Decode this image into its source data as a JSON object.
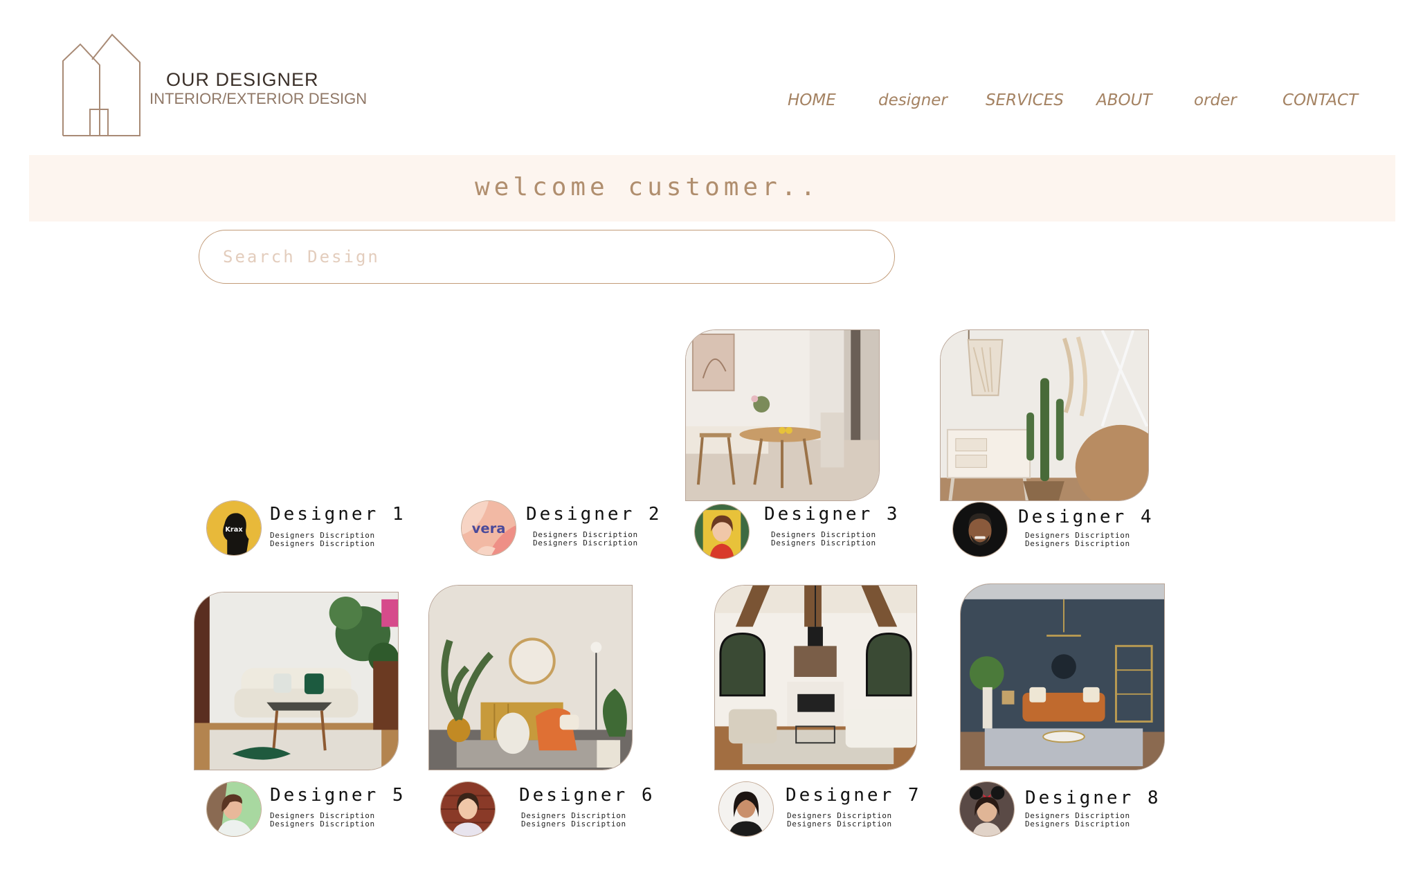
{
  "brand": {
    "title": "OUR DESIGNER",
    "subtitle": "INTERIOR/EXTERIOR DESIGN",
    "logo_icon": "house-outline-icon"
  },
  "nav": {
    "items": [
      {
        "label": "HOME"
      },
      {
        "label": "designer"
      },
      {
        "label": "SERVICES"
      },
      {
        "label": "ABOUT"
      },
      {
        "label": "order"
      },
      {
        "label": "CONTACT"
      }
    ]
  },
  "welcome": {
    "text": "welcome customer.."
  },
  "search": {
    "placeholder": "Search Design",
    "value": ""
  },
  "colors": {
    "accent": "#a48262",
    "band": "#fdf5ef",
    "search_border": "#c29b78"
  },
  "designers": [
    {
      "name": "Designer 1",
      "desc_line1": "Designers Discription",
      "desc_line2": "Designers Discription",
      "avatar_text": "Krax"
    },
    {
      "name": "Designer 2",
      "desc_line1": "Designers Discription",
      "desc_line2": "Designers Discription",
      "avatar_text": "vera"
    },
    {
      "name": "Designer 3",
      "desc_line1": "Designers Discription",
      "desc_line2": "Designers Discription"
    },
    {
      "name": "Designer 4",
      "desc_line1": "Designers Discription",
      "desc_line2": "Designers Discription"
    },
    {
      "name": "Designer 5",
      "desc_line1": "Designers Discription",
      "desc_line2": "Designers Discription"
    },
    {
      "name": "Designer 6",
      "desc_line1": "Designers Discription",
      "desc_line2": "Designers Discription"
    },
    {
      "name": "Designer 7",
      "desc_line1": "Designers Discription",
      "desc_line2": "Designers Discription"
    },
    {
      "name": "Designer 8",
      "desc_line1": "Designers Discription",
      "desc_line2": "Designers Discription"
    }
  ]
}
